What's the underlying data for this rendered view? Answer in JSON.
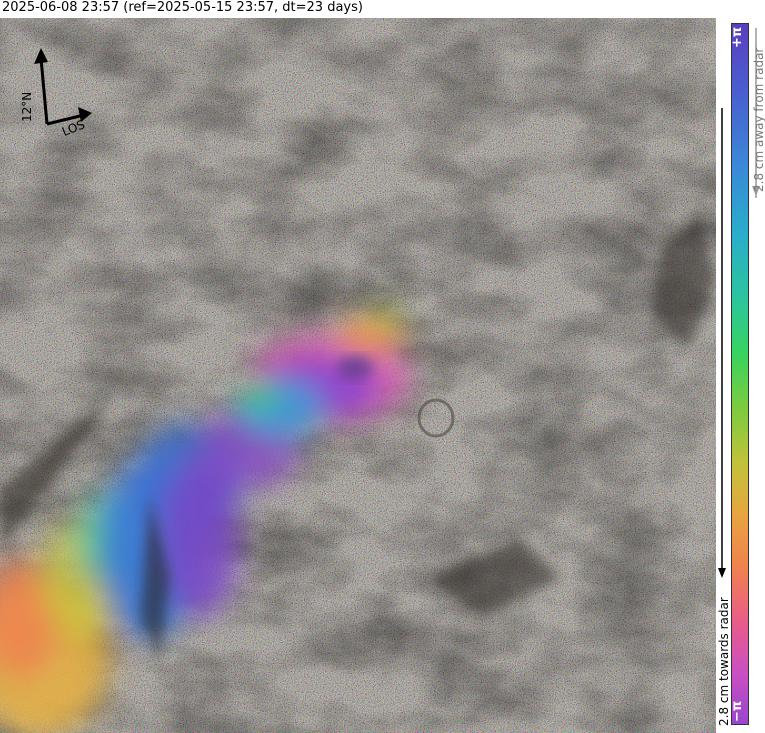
{
  "header": {
    "title": "2025-06-08 23:57 (ref=2025-05-15 23:57, dt=23 days)"
  },
  "map": {
    "description_type": "interferogram-overlay",
    "colors": {
      "purple": "#7a45c8",
      "blue": "#3a78d8",
      "cyan": "#2fc0c0",
      "green": "#3fd060",
      "yellow": "#d0c03a",
      "orange": "#f08040",
      "magenta": "#e050b0"
    }
  },
  "compass": {
    "north_label": "12°N",
    "los_label": "LOS"
  },
  "colorbar": {
    "top_label": "+π",
    "bottom_label": "−π",
    "away_label": "2.8 cm away from radar",
    "toward_label": "2.8 cm towards radar"
  }
}
